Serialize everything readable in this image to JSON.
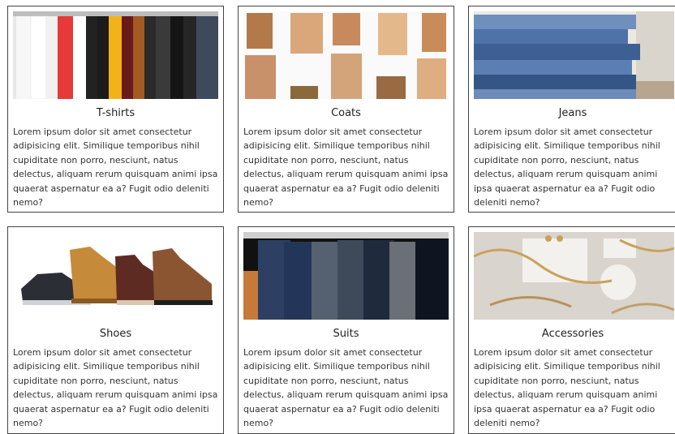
{
  "categories": [
    {
      "title": "T-shirts",
      "description": "Lorem ipsum dolor sit amet consectetur adipisicing elit. Similique temporibus nihil cupiditate non porro, nesciunt, natus delectus, aliquam rerum quisquam animi ipsa quaerat aspernatur ea a? Fugit odio deleniti nemo?",
      "image_icon": "tshirts-rack-image",
      "accent": "#e23b3b"
    },
    {
      "title": "Coats",
      "description": "Lorem ipsum dolor sit amet consectetur adipisicing elit. Similique temporibus nihil cupiditate non porro, nesciunt, natus delectus, aliquam rerum quisquam animi ipsa quaerat aspernatur ea a? Fugit odio deleniti nemo?",
      "image_icon": "coats-grid-image",
      "accent": "#c28a5a"
    },
    {
      "title": "Jeans",
      "description": "Lorem ipsum dolor sit amet consectetur adipisicing elit. Similique temporibus nihil cupiditate non porro, nesciunt, natus delectus, aliquam rerum quisquam animi ipsa quaerat aspernatur ea a? Fugit odio deleniti nemo?",
      "image_icon": "jeans-stack-image",
      "accent": "#3a5f8f"
    },
    {
      "title": "Shoes",
      "description": "Lorem ipsum dolor sit amet consectetur adipisicing elit. Similique temporibus nihil cupiditate non porro, nesciunt, natus delectus, aliquam rerum quisquam animi ipsa quaerat aspernatur ea a? Fugit odio deleniti nemo?",
      "image_icon": "shoes-image",
      "accent": "#b9782f"
    },
    {
      "title": "Suits",
      "description": "Lorem ipsum dolor sit amet consectetur adipisicing elit. Similique temporibus nihil cupiditate non porro, nesciunt, natus delectus, aliquam rerum quisquam animi ipsa quaerat aspernatur ea a? Fugit odio deleniti nemo?",
      "image_icon": "suits-rack-image",
      "accent": "#2d3f63"
    },
    {
      "title": "Accessories",
      "description": "Lorem ipsum dolor sit amet consectetur adipisicing elit. Similique temporibus nihil cupiditate non porro, nesciunt, natus delectus, aliquam rerum quisquam animi ipsa quaerat aspernatur ea a? Fugit odio deleniti nemo?",
      "image_icon": "jewelry-image",
      "accent": "#c9a25a"
    }
  ]
}
